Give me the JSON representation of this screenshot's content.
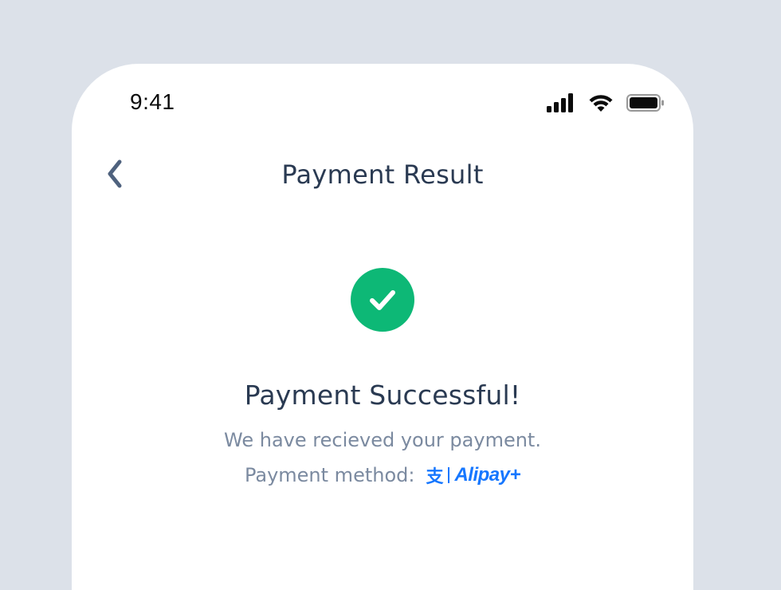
{
  "status_bar": {
    "time": "9:41",
    "icons": [
      "signal-icon",
      "wifi-icon",
      "battery-icon"
    ]
  },
  "nav": {
    "back_icon": "chevron-left-icon",
    "title": "Payment Result"
  },
  "result": {
    "status_icon": "check-circle-icon",
    "status_color": "#0db876",
    "title": "Payment Successful!",
    "subtitle": "We have recieved your payment.",
    "method_label": "Payment method:",
    "method_logo": {
      "char": "支",
      "word": "Alipay+",
      "brand_color": "#1677ff"
    }
  },
  "colors": {
    "background": "#dce1e9",
    "card": "#ffffff",
    "heading": "#2a3a52",
    "muted": "#7b8aa0"
  }
}
